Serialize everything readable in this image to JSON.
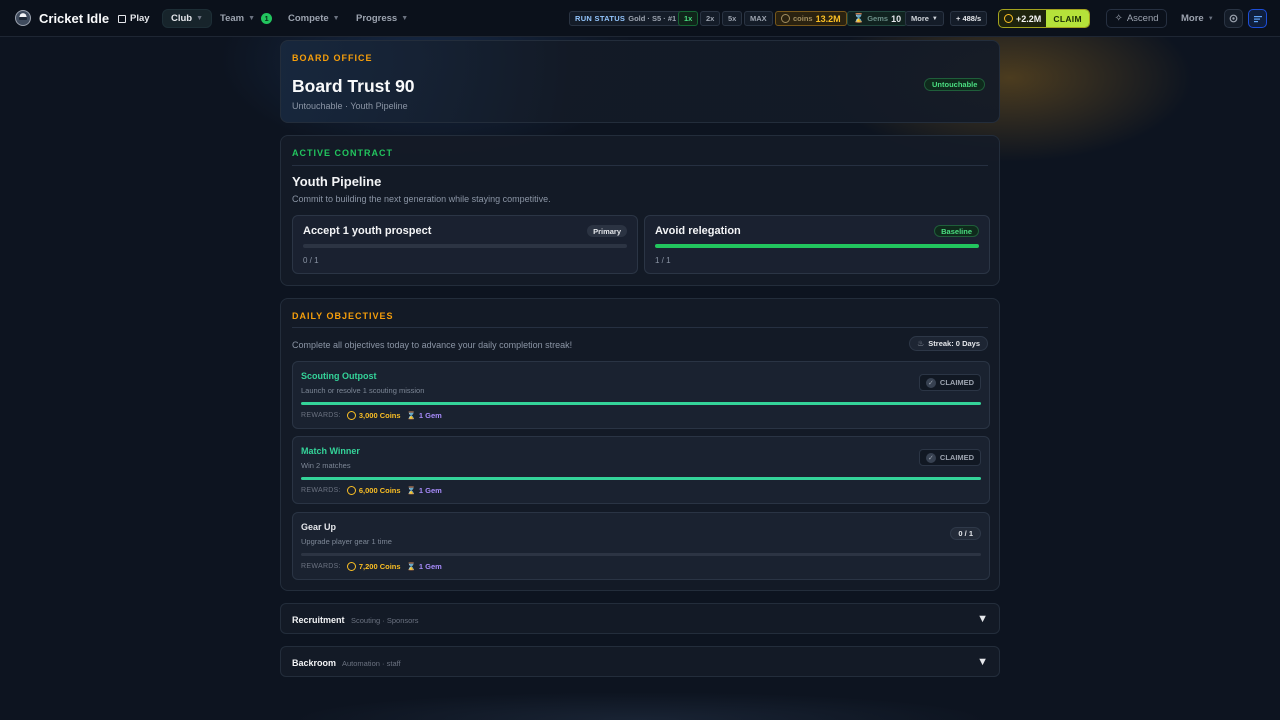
{
  "app": {
    "title": "Cricket Idle"
  },
  "nav": {
    "play": "Play",
    "club": "Club",
    "team": "Team",
    "team_badge": "1",
    "compete": "Compete",
    "progress": "Progress"
  },
  "status": {
    "run_label": "RUN STATUS",
    "run_value": "Gold · S5 · #1",
    "speeds": [
      "1x",
      "2x",
      "5x",
      "MAX"
    ],
    "active_speed": "1x",
    "coins_label": "coins",
    "coins_value": "13.2M",
    "gems_label": "Gems",
    "gems_value": "10",
    "more": "More",
    "rate": "+ 488/s",
    "claim_amount": "+2.2M",
    "claim_label": "CLAIM",
    "ascend": "Ascend",
    "more_menu": "More"
  },
  "board": {
    "section": "BOARD OFFICE",
    "title": "Board Trust 90",
    "subtitle": "Untouchable · Youth Pipeline",
    "badge": "Untouchable"
  },
  "contract": {
    "section": "ACTIVE CONTRACT",
    "title": "Youth Pipeline",
    "description": "Commit to building the next generation while staying competitive.",
    "objectives": [
      {
        "title": "Accept 1 youth prospect",
        "tag": "Primary",
        "progress_text": "0 / 1",
        "progress": 0
      },
      {
        "title": "Avoid relegation",
        "tag": "Baseline",
        "progress_text": "1 / 1",
        "progress": 1
      }
    ]
  },
  "daily": {
    "section": "DAILY OBJECTIVES",
    "description": "Complete all objectives today to advance your daily completion streak!",
    "streak": "Streak: 0 Days",
    "rewards_label": "REWARDS:",
    "claimed_label": "CLAIMED",
    "tasks": [
      {
        "title": "Scouting Outpost",
        "description": "Launch or resolve 1 scouting mission",
        "coins": "3,000 Coins",
        "gems": "1 Gem",
        "progress": 1
      },
      {
        "title": "Match Winner",
        "description": "Win 2 matches",
        "coins": "6,000 Coins",
        "gems": "1 Gem",
        "progress": 1
      },
      {
        "title": "Gear Up",
        "description": "Upgrade player gear 1 time",
        "coins": "7,200 Coins",
        "gems": "1 Gem",
        "progress": 0,
        "count": "0 / 1"
      }
    ]
  },
  "collapsibles": [
    {
      "title": "Recruitment",
      "subtitle": "Scouting · Sponsors"
    },
    {
      "title": "Backroom",
      "subtitle": "Automation · staff"
    }
  ],
  "colors": {
    "accent_green": "#22c55e",
    "accent_amber": "#f59e0b",
    "claim_lime": "#b5e23a"
  }
}
